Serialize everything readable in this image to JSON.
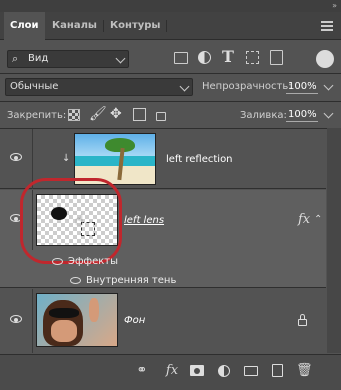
{
  "tabs": [
    {
      "label": "Слои",
      "active": true
    },
    {
      "label": "Каналы",
      "active": false
    },
    {
      "label": "Контуры",
      "active": false
    }
  ],
  "filter": {
    "value": "Вид"
  },
  "blend_mode": "Обычные",
  "opacity": {
    "label": "Непрозрачность:",
    "value": "100%"
  },
  "lock": {
    "label": "Закрепить:"
  },
  "fill": {
    "label": "Заливка:",
    "value": "100%"
  },
  "layers": [
    {
      "name": "left reflection",
      "visible": true,
      "clipped": true
    },
    {
      "name": "left lens",
      "visible": true,
      "has_fx": true,
      "fx_label": "fx",
      "effects_label": "Эффекты",
      "effect_item": "Внутренняя тень"
    },
    {
      "name": "Фон",
      "visible": true,
      "locked": true
    }
  ],
  "colors": {
    "panel": "#535353",
    "selected_layer": "#5f5f5f",
    "highlight_ring": "#c0272d"
  }
}
